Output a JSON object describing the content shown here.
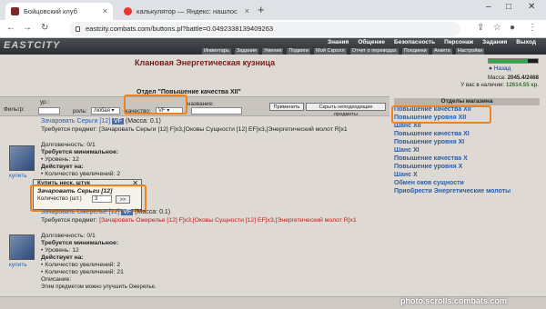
{
  "browser": {
    "tabs": [
      {
        "label": "Бойцовский клуб",
        "active": true
      },
      {
        "label": "калькулятор — Яндекс: нашлос",
        "active": false
      }
    ],
    "url": "eastcity.combats.com/buttons.pl?battle=0.0492338139409263"
  },
  "game": {
    "logo": "EASTCITY",
    "menu": [
      "Знания",
      "Общение",
      "Безопасность",
      "Персонаж",
      "Задания",
      "Выход"
    ],
    "submenu": [
      "Инвентарь",
      "Задания",
      "Умения",
      "Подвиги",
      "Мой Скролл",
      "Отчет о переводах",
      "Поединки",
      "Анкета",
      "Настройки"
    ],
    "title": "Клановая Энергетическая кузница",
    "back_label": "Назад",
    "mass_label": "Масса:",
    "mass_value": "2045.4/2468",
    "money_label": "У вас в наличии:",
    "money_value": "12614.55 кр.",
    "panel_title": "Отдел \"Повышение качества XII\"",
    "filter": {
      "level_label": "ур.:",
      "role_label": "роль:",
      "role_value": "любая",
      "quality_label": "качество:",
      "quality_value": "VF",
      "name_label": "название:",
      "filter_label": "Фильтр:",
      "apply_button": "Применить",
      "hide_button": "Скрыть неподходящие предметы"
    },
    "items": [
      {
        "name": "Зачаровать Серьги [12]",
        "badge": "VF",
        "mass": "(Масса: 0.1)",
        "requires": "Требуется предмет: [Зачаровать Серьги [12] F]x3,[Оковы Сущности [12] EF]x3,[Энергетический молот R]x1",
        "durability": "Долговечность: 0/1",
        "min_req": "Требуется минимальное:",
        "level": "• Уровень: 12",
        "acts": "Действует на:",
        "count": "• Количество увеличений: 2",
        "buy": "купить"
      },
      {
        "name": "Зачаровать Ожерелье [12]",
        "badge": "VF",
        "mass": "(Масса: 0.1)",
        "requires_prefix": "Требуется предмет: ",
        "requires_red": "[Зачаровать Ожерелье [12] F]x3,[Оковы Сущности [12] EF]x3,[Энергетический молот R]x1",
        "durability": "Долговечность: 0/1",
        "min_req": "Требуется минимальное:",
        "level": "• Уровень: 12",
        "acts": "Действует на:",
        "count": "• Количество увеличений: 2",
        "count_max": "• Количество увеличений: 21",
        "desc": "Описание:",
        "desc_text": "Этим предметом можно улучшить Ожерелье.",
        "buy": "купить"
      }
    ],
    "popup": {
      "title": "Купить неск. штук",
      "item": "Зачаровать Серьги [12]",
      "qty_label": "Количество (шт.)",
      "qty_value": "3",
      "ok": ">>"
    },
    "right_list": {
      "header": "Отделы магазина",
      "items": [
        "Повышение качества XII",
        "Повышение уровня XII",
        "Шанс XII",
        "Повышение качества XI",
        "Повышение уровня XI",
        "Шанс XI",
        "Повышение качества X",
        "Повышение уровня X",
        "Шанс X",
        "Обмен оков сущности",
        "Приобрести Энергетические молоты"
      ]
    },
    "watermark": "photo.scrolls.combats.com"
  }
}
